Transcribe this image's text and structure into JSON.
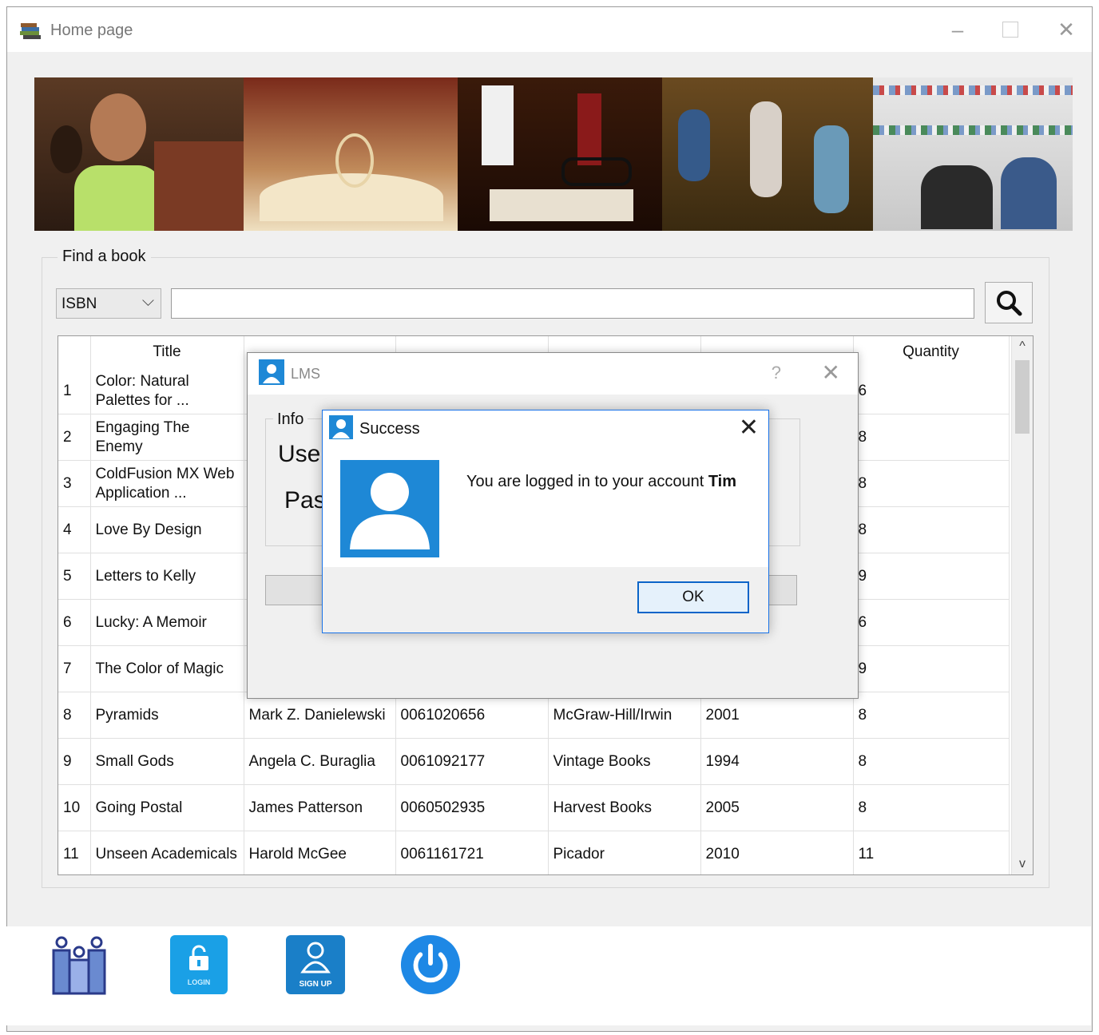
{
  "window": {
    "title": "Home page"
  },
  "find": {
    "group_label": "Find a book",
    "search_by": "ISBN",
    "query": ""
  },
  "table": {
    "headers": [
      "",
      "Title",
      "",
      "",
      "",
      "",
      "Quantity"
    ],
    "rows": [
      {
        "n": "1",
        "title": "Color: Natural Palettes for ...",
        "author": "",
        "isbn": "",
        "publisher": "",
        "year": "",
        "qty": "6"
      },
      {
        "n": "2",
        "title": "Engaging The Enemy",
        "author": "",
        "isbn": "",
        "publisher": "",
        "year": "",
        "qty": "8"
      },
      {
        "n": "3",
        "title": "ColdFusion MX Web Application ...",
        "author": "",
        "isbn": "",
        "publisher": "",
        "year": "",
        "qty": "8"
      },
      {
        "n": "4",
        "title": "Love By Design",
        "author": "",
        "isbn": "",
        "publisher": "",
        "year": "",
        "qty": "8"
      },
      {
        "n": "5",
        "title": "Letters to Kelly",
        "author": "",
        "isbn": "",
        "publisher": "",
        "year": "",
        "qty": "9"
      },
      {
        "n": "6",
        "title": "Lucky: A Memoir",
        "author": "",
        "isbn": "",
        "publisher": "",
        "year": "",
        "qty": "6"
      },
      {
        "n": "7",
        "title": "The Color of Magic",
        "author": "",
        "isbn": "",
        "publisher": "",
        "year": "",
        "qty": "9"
      },
      {
        "n": "8",
        "title": "Pyramids",
        "author": "Mark Z. Danielewski",
        "isbn": "0061020656",
        "publisher": "McGraw-Hill/Irwin",
        "year": "2001",
        "qty": "8"
      },
      {
        "n": "9",
        "title": "Small Gods",
        "author": "Angela C. Buraglia",
        "isbn": "0061092177",
        "publisher": "Vintage Books",
        "year": "1994",
        "qty": "8"
      },
      {
        "n": "10",
        "title": "Going Postal",
        "author": "James Patterson",
        "isbn": "0060502935",
        "publisher": "Harvest Books",
        "year": "2005",
        "qty": "8"
      },
      {
        "n": "11",
        "title": "Unseen Academicals",
        "author": "Harold McGee",
        "isbn": "0061161721",
        "publisher": "Picador",
        "year": "2010",
        "qty": "11"
      }
    ]
  },
  "bottom": {
    "login_label": "LOGIN",
    "signup_label": "SIGN UP"
  },
  "lms_dialog": {
    "title": "LMS",
    "help": "?",
    "info_label": "Info",
    "user_label": "User",
    "pass_label": "Pas"
  },
  "success_dialog": {
    "title": "Success",
    "message": "You are logged in to your account",
    "username": "Tim",
    "ok_label": "OK"
  },
  "colors": {
    "accent": "#1a73e8",
    "avatar_blue": "#1e88d6",
    "login_blue": "#1aa0e6",
    "signup_blue": "#1a7fc8",
    "power_blue": "#1e88e5"
  }
}
